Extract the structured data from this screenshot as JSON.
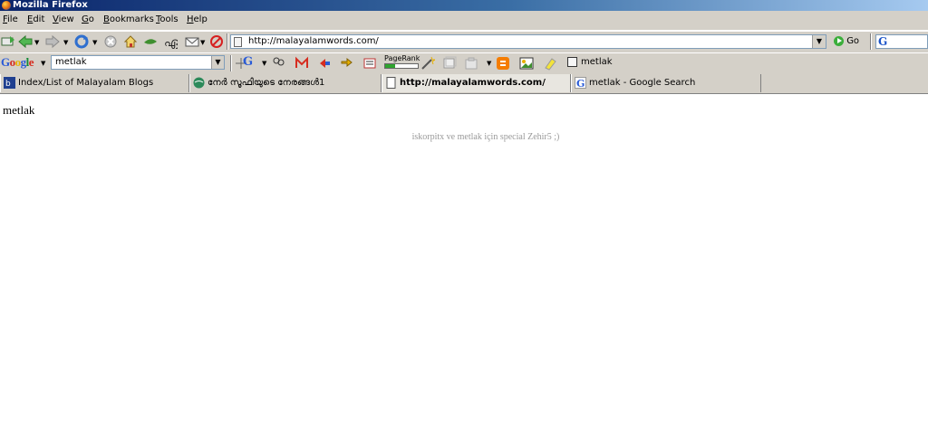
{
  "window": {
    "title": "Mozilla Firefox"
  },
  "menu": {
    "items": [
      {
        "key": "F",
        "rest": "ile"
      },
      {
        "key": "E",
        "rest": "dit"
      },
      {
        "key": "V",
        "rest": "iew"
      },
      {
        "key": "G",
        "rest": "o"
      },
      {
        "key": "B",
        "rest": "ookmarks"
      },
      {
        "key": "T",
        "rest": "ools"
      },
      {
        "key": "H",
        "rest": "elp"
      }
    ]
  },
  "navigation": {
    "url": "http://malayalamwords.com/",
    "go_label": "Go",
    "search_engine_glyph": "G"
  },
  "google_toolbar": {
    "logo_parts": [
      "G",
      "o",
      "o",
      "g",
      "l",
      "e"
    ],
    "search_value": "metlak",
    "toolbar_g_glyph": "G",
    "pagerank_label": "PageRank",
    "pagerank_fill": 0.3,
    "query_label": "metlak",
    "colors": {
      "blue": "#2a5bd7",
      "red": "#d62d20",
      "yellow": "#e8b100",
      "green": "#138a36"
    }
  },
  "tabs": [
    {
      "label": "Index/List of Malayalam Blogs",
      "active": false,
      "icon": "blog-list-icon"
    },
    {
      "label": "നേര്‍ സൂഫിയുടെ നേരങ്ങള്‍1",
      "active": false,
      "icon": "globe-icon"
    },
    {
      "label": "http://malayalamwords.com/",
      "active": true,
      "icon": "page-icon"
    },
    {
      "label": "metlak - Google Search",
      "active": false,
      "icon": "google-icon"
    }
  ],
  "page": {
    "heading": "metlak",
    "credit": "iskorpitx ve metlak için special Zehir5 ;)"
  }
}
